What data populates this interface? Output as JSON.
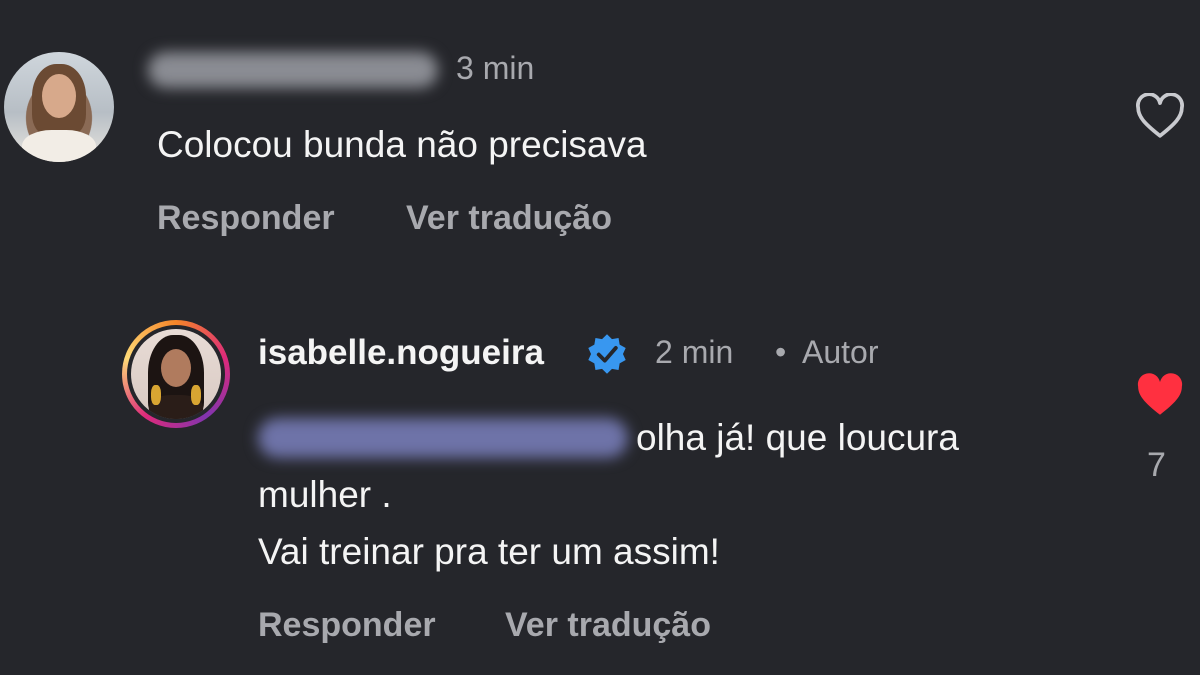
{
  "comments": [
    {
      "time": "3 min",
      "text": "Colocou bunda não precisava",
      "reply_label": "Responder",
      "translate_label": "Ver tradução",
      "like_icon": "heart-outline-icon"
    },
    {
      "username": "isabelle.nogueira",
      "verified_icon": "verified-badge-icon",
      "time": "2 min",
      "separator": "•",
      "author_tag": "Autor",
      "text_line1": "olha já! que loucura",
      "text_line2": "mulher .",
      "text_line3": "Vai treinar pra ter um assim!",
      "reply_label": "Responder",
      "translate_label": "Ver tradução",
      "like_icon": "heart-filled-icon",
      "like_count": "7",
      "like_color": "#ff3040"
    }
  ],
  "colors": {
    "background": "#25262b",
    "verified": "#3897f0"
  }
}
